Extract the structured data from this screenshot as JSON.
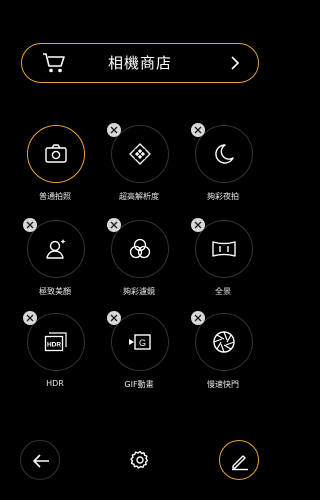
{
  "store": {
    "title": "相機商店",
    "icons": [
      "cart-icon",
      "chevron-right-icon"
    ]
  },
  "modes": [
    {
      "label": "普通拍照",
      "icon": "camera-icon",
      "active": true,
      "removable": false
    },
    {
      "label": "超高解析度",
      "icon": "hi-res-icon",
      "active": false,
      "removable": true
    },
    {
      "label": "夠彩夜拍",
      "icon": "moon-icon",
      "active": false,
      "removable": true
    },
    {
      "label": "極致美顏",
      "icon": "beauty-icon",
      "active": false,
      "removable": true
    },
    {
      "label": "夠彩濾鏡",
      "icon": "filter-icon",
      "active": false,
      "removable": true
    },
    {
      "label": "全景",
      "icon": "panorama-icon",
      "active": false,
      "removable": true
    },
    {
      "label": "HDR",
      "icon": "hdr-icon",
      "active": false,
      "removable": true
    },
    {
      "label": "GIF動畫",
      "icon": "gif-icon",
      "active": false,
      "removable": true
    },
    {
      "label": "慢速快門",
      "icon": "shutter-icon",
      "active": false,
      "removable": true
    }
  ],
  "bottom_bar": {
    "icons": [
      "back-arrow-icon",
      "gear-icon",
      "edit-pencil-icon"
    ]
  },
  "colors": {
    "accent": "#e6a33c",
    "background": "#000000",
    "remove_badge": "#d8d8d8"
  }
}
